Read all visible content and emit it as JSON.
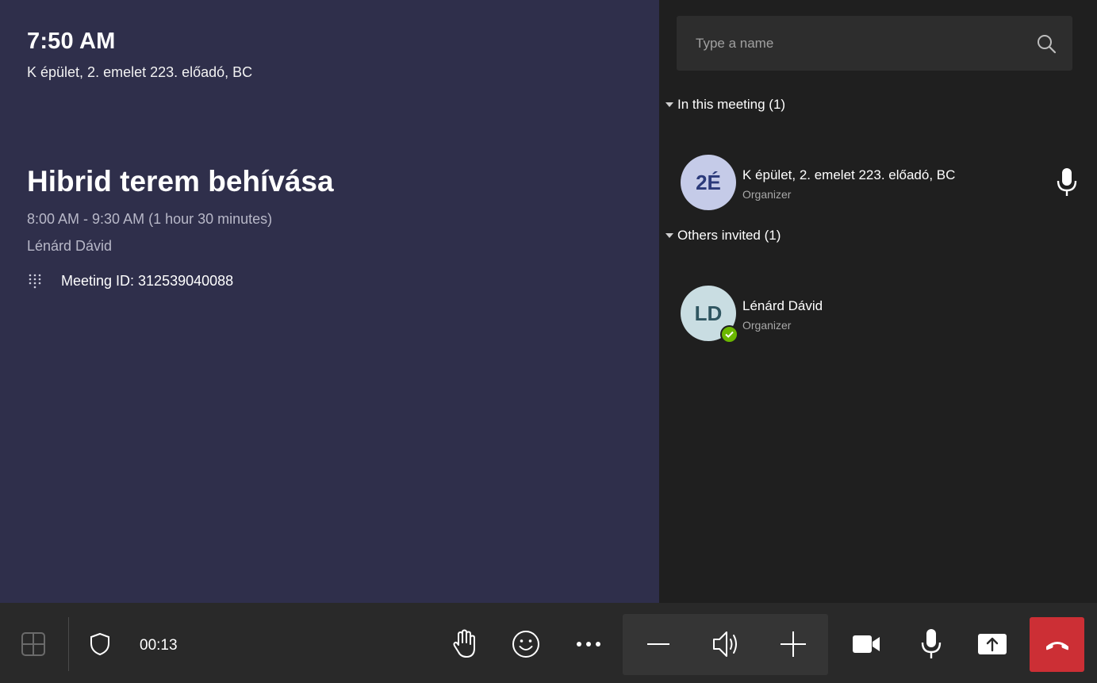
{
  "stage": {
    "clock": "7:50 AM",
    "room": "K épület, 2. emelet 223. előadó, BC",
    "meeting_title": "Hibrid terem behívása",
    "meeting_time": "8:00 AM - 9:30 AM (1 hour 30 minutes)",
    "meeting_organizer": "Lénárd Dávid",
    "meeting_id": "Meeting ID: 312539040088"
  },
  "roster": {
    "search_placeholder": "Type a name",
    "sections": [
      {
        "header": "In this meeting (1)",
        "participants": [
          {
            "initials": "2É",
            "name": "K épület, 2. emelet 223. előadó, BC",
            "role": "Organizer",
            "icon": "microphone-icon"
          }
        ]
      },
      {
        "header": "Others invited (1)",
        "participants": [
          {
            "initials": "LD",
            "name": "Lénárd Dávid",
            "role": "Organizer",
            "presence": "available"
          }
        ]
      }
    ]
  },
  "toolbar": {
    "timer": "00:13",
    "icons": [
      "layout-icon",
      "shield-icon",
      "raise-hand-icon",
      "emoji-icon",
      "more-icon",
      "volume-down-icon",
      "speaker-icon",
      "volume-up-icon",
      "camera-icon",
      "microphone-icon",
      "share-icon",
      "hang-up-icon"
    ]
  },
  "colors": {
    "stage_bg": "#2f2f4b",
    "roster_bg": "#1f1f1f",
    "toolbar_bg": "#292929",
    "hangup_red": "#cc2f35",
    "presence_green": "#6bb700"
  }
}
